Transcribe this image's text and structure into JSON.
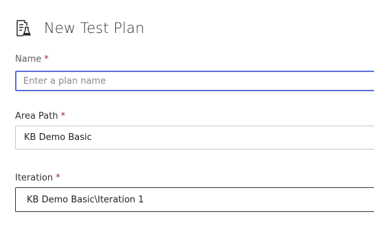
{
  "header": {
    "icon": "test-plan-icon",
    "title": "New Test Plan"
  },
  "form": {
    "name": {
      "label": "Name",
      "required_marker": "*",
      "value": "",
      "placeholder": "Enter a plan name"
    },
    "area_path": {
      "label": "Area Path",
      "required_marker": "*",
      "value": "KB Demo Basic"
    },
    "iteration": {
      "label": "Iteration",
      "required_marker": "*",
      "value": "KB Demo Basic\\Iteration 1"
    }
  },
  "colors": {
    "focus_border": "#5b6cd8",
    "required": "#a4262c",
    "text": "#201f1e"
  }
}
